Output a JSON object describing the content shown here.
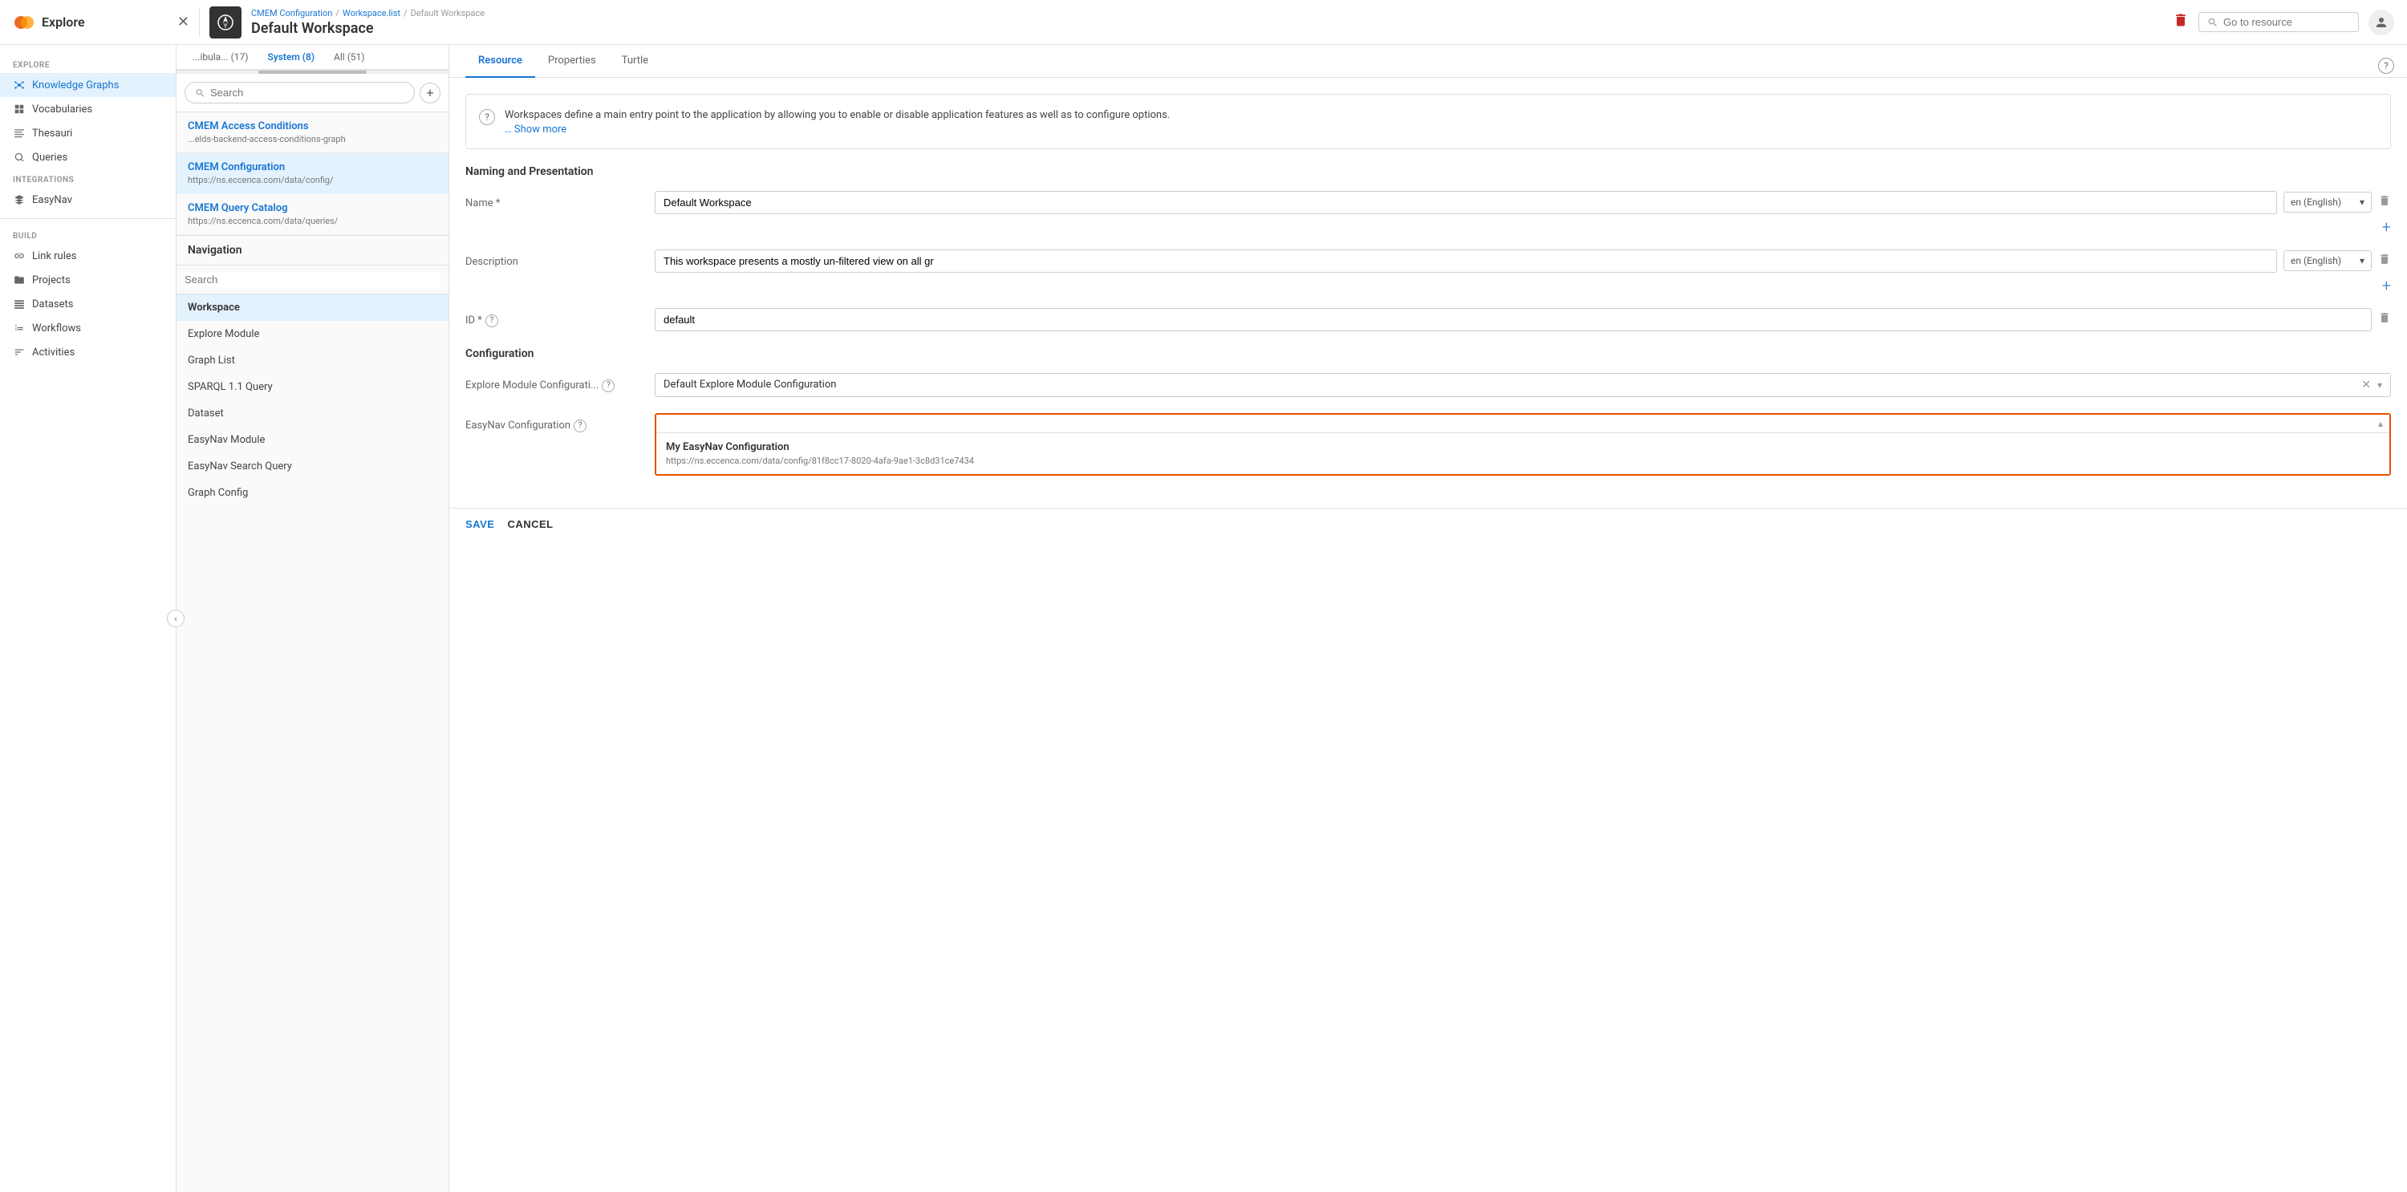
{
  "header": {
    "app_name": "Explore",
    "breadcrumb": [
      {
        "label": "CMEM Configuration",
        "href": "#"
      },
      {
        "label": "Workspace.list",
        "href": "#"
      },
      {
        "label": "Default Workspace"
      }
    ],
    "page_title": "Default Workspace",
    "search_placeholder": "Go to resource",
    "delete_label": "delete"
  },
  "sidebar": {
    "explore_label": "EXPLORE",
    "build_label": "BUILD",
    "items_explore": [
      {
        "label": "Knowledge Graphs",
        "icon": "graph-icon",
        "active": true
      },
      {
        "label": "Vocabularies",
        "icon": "vocab-icon",
        "active": false
      },
      {
        "label": "Thesauri",
        "icon": "thesauri-icon",
        "active": false
      },
      {
        "label": "Queries",
        "icon": "queries-icon",
        "active": false
      }
    ],
    "integrations_label": "INTEGRATIONS",
    "items_integrations": [
      {
        "label": "EasyNav",
        "icon": "easynav-icon",
        "active": false
      }
    ],
    "items_build": [
      {
        "label": "Link rules",
        "icon": "link-icon",
        "active": false
      },
      {
        "label": "Projects",
        "icon": "projects-icon",
        "active": false
      },
      {
        "label": "Datasets",
        "icon": "datasets-icon",
        "active": false
      },
      {
        "label": "Workflows",
        "icon": "workflows-icon",
        "active": false
      },
      {
        "label": "Activities",
        "icon": "activities-icon",
        "active": false
      }
    ]
  },
  "middle": {
    "tabs": [
      {
        "label": "...ibula... (17)",
        "active": false
      },
      {
        "label": "System (8)",
        "active": true
      },
      {
        "label": "All (51)",
        "active": false
      }
    ],
    "search_placeholder": "Search",
    "list_items": [
      {
        "title": "CMEM Access Conditions",
        "subtitle": "...elds-backend-access-conditions-graph",
        "active": false
      },
      {
        "title": "CMEM Configuration",
        "subtitle": "https://ns.eccenca.com/data/config/",
        "active": true
      },
      {
        "title": "CMEM Query Catalog",
        "subtitle": "https://ns.eccenca.com/data/queries/",
        "active": false
      }
    ],
    "navigation": {
      "title": "Navigation",
      "search_placeholder": "Search",
      "items": [
        {
          "label": "Workspace",
          "active": true
        },
        {
          "label": "Explore Module",
          "active": false
        },
        {
          "label": "Graph List",
          "active": false
        },
        {
          "label": "SPARQL 1.1 Query",
          "active": false
        },
        {
          "label": "Dataset",
          "active": false
        },
        {
          "label": "EasyNav Module",
          "active": false
        },
        {
          "label": "EasyNav Search Query",
          "active": false
        },
        {
          "label": "Graph Config",
          "active": false
        }
      ]
    }
  },
  "resource": {
    "tabs": [
      {
        "label": "Resource",
        "active": true
      },
      {
        "label": "Properties",
        "active": false
      },
      {
        "label": "Turtle",
        "active": false
      }
    ],
    "info_text": "Workspaces define a main entry point to the application by allowing you to enable or disable application features as well as to configure options.",
    "show_more": "… Show more",
    "naming_section": "Naming and Presentation",
    "name_label": "Name *",
    "name_value": "Default Workspace",
    "name_lang": "en (English)",
    "description_label": "Description",
    "description_value": "This workspace presents a mostly un-filtered view on all gr",
    "description_lang": "en (English)",
    "id_label": "ID *",
    "id_value": "default",
    "config_section": "Configuration",
    "explore_config_label": "Explore Module Configurati...",
    "explore_config_value": "Default Explore Module Configuration",
    "easynav_config_label": "EasyNav Configuration",
    "easynav_option_title": "My EasyNav Configuration",
    "easynav_option_url": "https://ns.eccenca.com/data/config/81f8cc17-8020-4afa-9ae1-3c8d31ce7434",
    "save_label": "SAVE",
    "cancel_label": "CANCEL"
  }
}
